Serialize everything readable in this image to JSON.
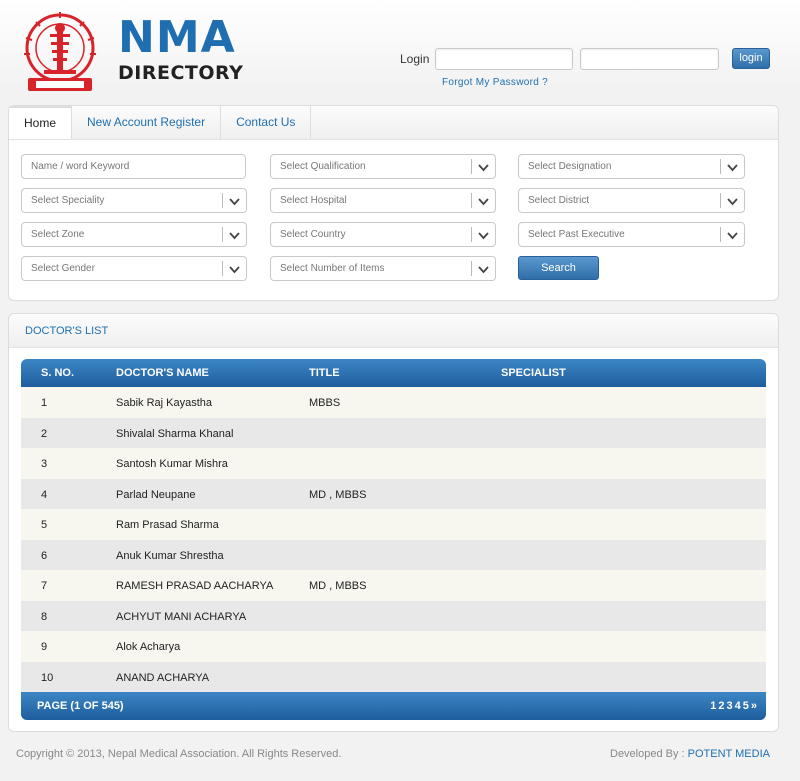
{
  "logo": {
    "title": "NMA",
    "subtitle": "DIRECTORY",
    "seal_text": "Nepal Medical Association",
    "seal_motto": "UNITY FRATERNITY SERVICE"
  },
  "login": {
    "label": "Login",
    "username_placeholder": "",
    "password_placeholder": "",
    "button": "login",
    "forgot": "Forgot My Password ?"
  },
  "nav": {
    "items": [
      "Home",
      "New Account Register",
      "Contact Us"
    ]
  },
  "filters": {
    "keyword_placeholder": "Name / word Keyword",
    "qualification": "Select Qualification",
    "designation": "Select Designation",
    "speciality": "Select Speciality",
    "hospital": "Select Hospital",
    "district": "Select District",
    "zone": "Select Zone",
    "country": "Select Country",
    "past_executive": "Select Past Executive",
    "gender": "Select Gender",
    "items": "Select Number of Items",
    "search_button": "Search"
  },
  "list": {
    "heading": "DOCTOR'S LIST",
    "columns": [
      "S. NO.",
      "DOCTOR'S NAME",
      "TITLE",
      "SPECIALIST"
    ],
    "rows": [
      [
        "1",
        "Sabik Raj Kayastha",
        "MBBS",
        ""
      ],
      [
        "2",
        "Shivalal Sharma Khanal",
        "",
        ""
      ],
      [
        "3",
        "Santosh Kumar Mishra",
        "",
        ""
      ],
      [
        "4",
        "Parlad Neupane",
        "MD , MBBS",
        ""
      ],
      [
        "5",
        "Ram Prasad Sharma",
        "",
        ""
      ],
      [
        "6",
        "Anuk Kumar Shrestha",
        "",
        ""
      ],
      [
        "7",
        "RAMESH PRASAD AACHARYA",
        "MD , MBBS",
        ""
      ],
      [
        "8",
        "ACHYUT MANI ACHARYA",
        "",
        ""
      ],
      [
        "9",
        "Alok Acharya",
        "",
        ""
      ],
      [
        "10",
        "ANAND ACHARYA",
        "",
        ""
      ]
    ],
    "page_info": "PAGE (1 OF 545)",
    "pages": [
      "1",
      "2",
      "3",
      "4",
      "5",
      "»"
    ]
  },
  "footer": {
    "copyright": "Copyright © 2013, Nepal Medical Association. All Rights Reserved.",
    "developed_label": "Developed By : ",
    "developer": "POTENT MEDIA"
  },
  "colors": {
    "brand_blue": "#1f6fb0",
    "seal_red": "#d8232a",
    "header_bar": "#2a6fae"
  }
}
